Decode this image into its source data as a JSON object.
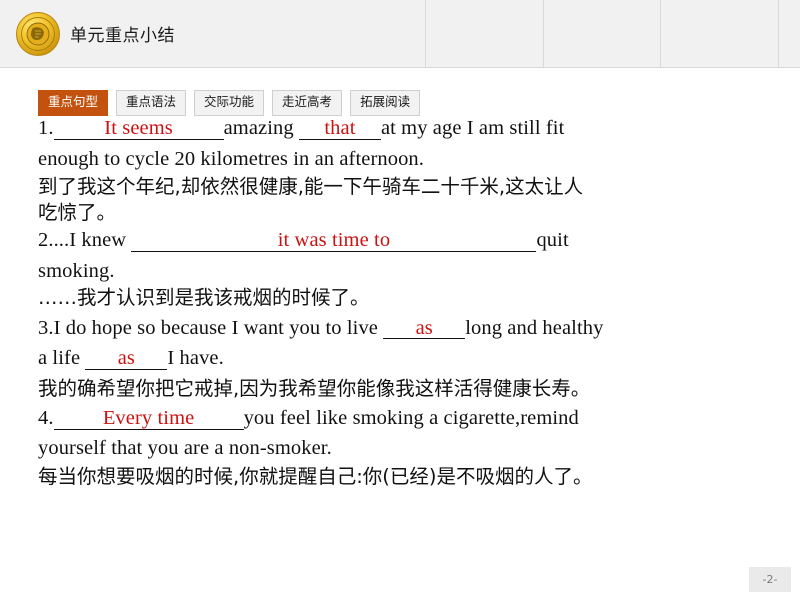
{
  "header": {
    "title": "单元重点小结",
    "emblem_icon": "gold-seal-emblem-icon"
  },
  "tabs": [
    {
      "label": "重点句型",
      "active": true
    },
    {
      "label": "重点语法",
      "active": false
    },
    {
      "label": "交际功能",
      "active": false
    },
    {
      "label": "走近高考",
      "active": false
    },
    {
      "label": "拓展阅读",
      "active": false
    }
  ],
  "content": {
    "item1": {
      "number": "1.",
      "blank1_answer": "It seems",
      "mid_text": "amazing",
      "blank2_answer": "that",
      "tail_text": "at my age I am still fit",
      "line2": "enough to cycle 20 kilometres in an afternoon.",
      "translation_line1": "到了我这个年纪,却依然很健康,能一下午骑车二十千米,这太让人",
      "translation_line2": "吃惊了。"
    },
    "item2": {
      "lead_text": "2....I knew",
      "blank1_answer": "it was time to",
      "tail_text": "quit",
      "line2": "smoking.",
      "translation": "……我才认识到是我该戒烟的时候了。"
    },
    "item3": {
      "lead_text": "3.I do hope so because I want you to live",
      "blank1_answer": "as",
      "mid_text": "long and healthy",
      "line2_lead": "a life",
      "blank2_answer": "as",
      "line2_tail": "I have.",
      "translation": "我的确希望你把它戒掉,因为我希望你能像我这样活得健康长寿。"
    },
    "item4": {
      "number": "4.",
      "blank1_answer": "Every time",
      "tail_text": "you feel like smoking a cigarette,remind",
      "line2": "yourself that you are a non-smoker.",
      "translation": "每当你想要吸烟的时候,你就提醒自己:你(已经)是不吸烟的人了。"
    }
  },
  "footer": {
    "page_label": "-2-"
  },
  "colors": {
    "active_tab": "#c2520e",
    "answer_text": "#cc1111",
    "header_bg": "#f1f1f1"
  }
}
